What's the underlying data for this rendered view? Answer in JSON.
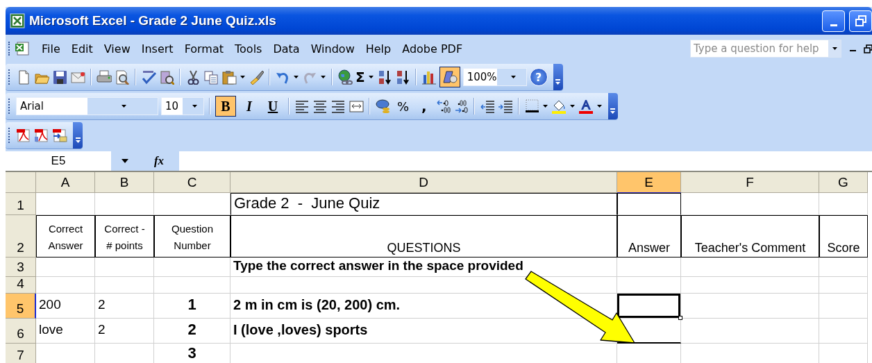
{
  "window": {
    "title": "Microsoft Excel - Grade 2 June Quiz.xls"
  },
  "menu": [
    "File",
    "Edit",
    "View",
    "Insert",
    "Format",
    "Tools",
    "Data",
    "Window",
    "Help",
    "Adobe PDF"
  ],
  "help_box": {
    "placeholder": "Type a question for help"
  },
  "standard_toolbar": {
    "sigma": "Σ",
    "drawing_selected": true,
    "zoom": "100%",
    "help": "?"
  },
  "formatting_toolbar": {
    "font": "Arial",
    "size_field": "10",
    "buttons": [
      {
        "label": "B",
        "selected": true
      },
      {
        "label": "I",
        "selected": false
      },
      {
        "label": "U",
        "selected": false
      }
    ],
    "percent": "%",
    "comma": ","
  },
  "formula_bar": {
    "name_box": "E5",
    "fx": "fx"
  },
  "sheet": {
    "columns": [
      {
        "label": "A",
        "selected": false
      },
      {
        "label": "B",
        "selected": false
      },
      {
        "label": "C",
        "selected": false
      },
      {
        "label": "D",
        "selected": false
      },
      {
        "label": "E",
        "selected": true
      },
      {
        "label": "F",
        "selected": false
      },
      {
        "label": "G",
        "selected": false
      }
    ],
    "rows": [
      {
        "label": "1",
        "selected": false,
        "kind": "title",
        "cells": {
          "D": "Grade 2  -  June Quiz"
        }
      },
      {
        "label": "2",
        "selected": false,
        "kind": "header",
        "cells": {
          "A": "Correct\nAnswer",
          "B": "Correct -\n# points",
          "C": "Question\nNumber",
          "D": "QUESTIONS",
          "E": "Answer",
          "F": "Teacher's Comment",
          "G": "Score"
        }
      },
      {
        "label": "3",
        "selected": false,
        "kind": "instruction",
        "cells": {
          "D": "Type the correct answer in the space provided"
        }
      },
      {
        "label": "4",
        "selected": false,
        "kind": "blank",
        "cells": {}
      },
      {
        "label": "5",
        "selected": true,
        "kind": "question",
        "cells": {
          "A": "200",
          "B": "2",
          "C": "1",
          "D": "2 m in cm is (20, 200) cm."
        }
      },
      {
        "label": "6",
        "selected": false,
        "kind": "question",
        "cells": {
          "A": "love",
          "B": "2",
          "C": "2",
          "D": "I (love ,loves) sports"
        }
      },
      {
        "label": "7",
        "selected": false,
        "kind": "question",
        "cells": {
          "C": "3"
        }
      }
    ],
    "annotations": [
      {
        "kind": "arrow"
      }
    ]
  }
}
